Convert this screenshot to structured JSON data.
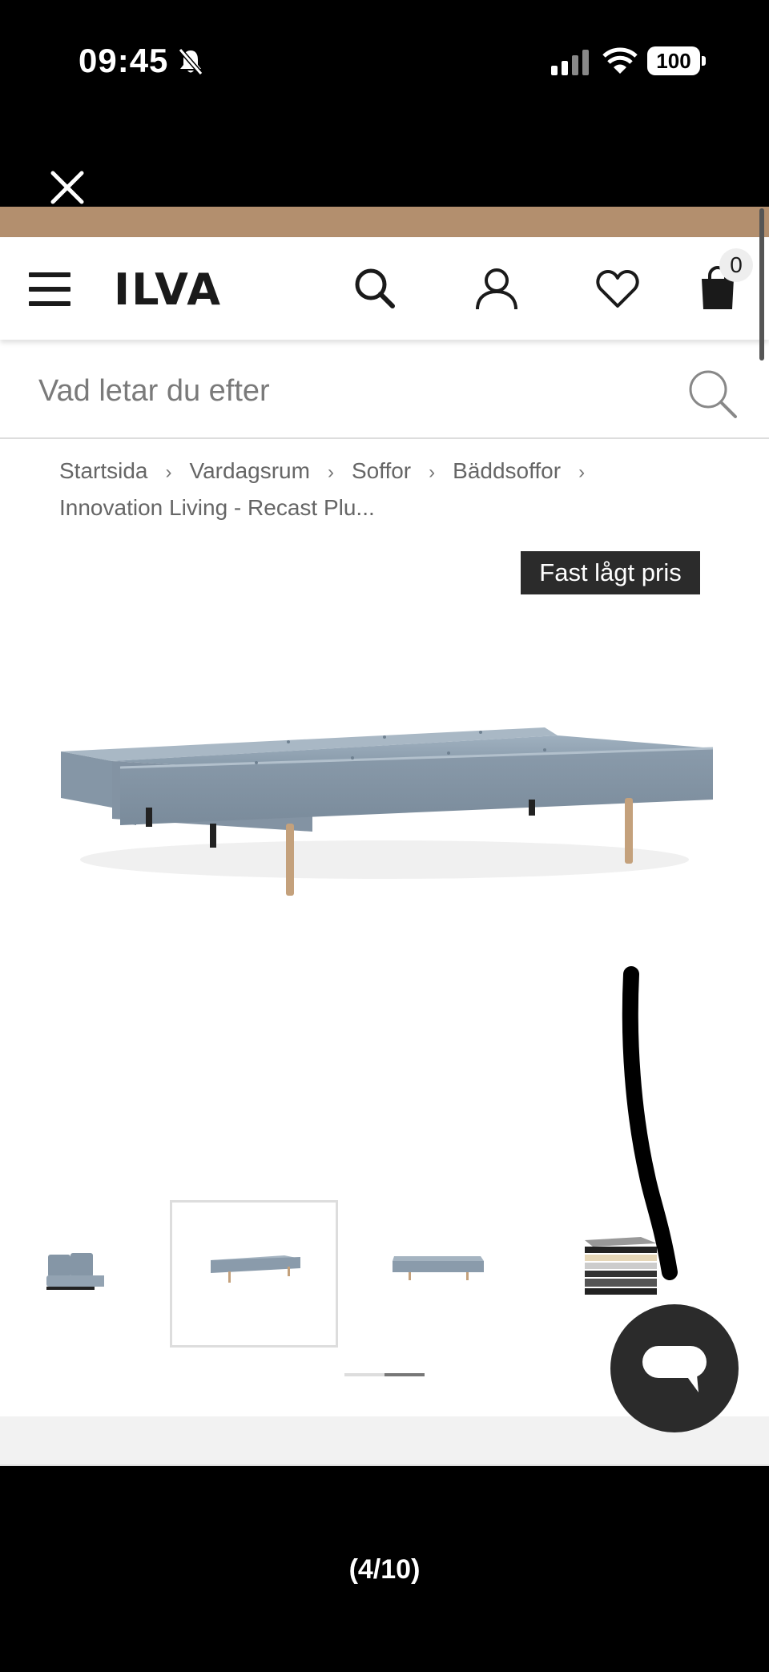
{
  "status_bar": {
    "time": "09:45",
    "battery": "100"
  },
  "site": {
    "logo": "ILVA",
    "cart_count": "0",
    "search_placeholder": "Vad letar du efter"
  },
  "breadcrumb": {
    "items": [
      "Startsida",
      "Vardagsrum",
      "Soffor",
      "Bäddsoffor",
      "Innovation Living - Recast Plu..."
    ],
    "separator": "›"
  },
  "product": {
    "badge": "Fast lågt pris"
  },
  "carousel": {
    "thumbnail_count": 4,
    "active_index": 1
  },
  "gallery": {
    "counter": "(4/10)"
  },
  "colors": {
    "promo": "#b38f6e",
    "badge_bg": "#2b2b2b",
    "sofa": "#8a9bab"
  }
}
